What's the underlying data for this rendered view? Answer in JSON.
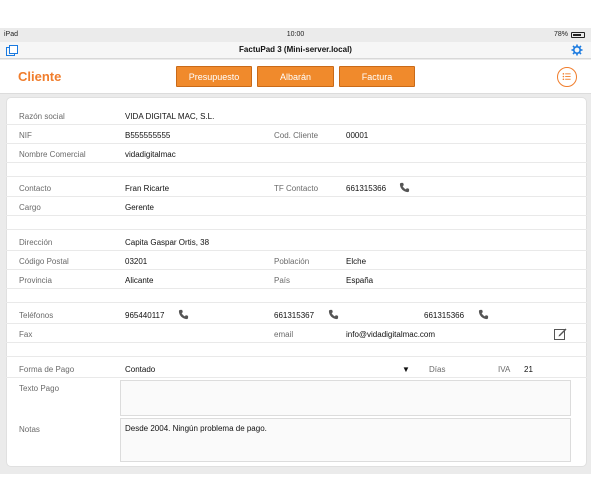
{
  "status_bar": {
    "left": "iPad",
    "time": "10:00",
    "battery": "78%"
  },
  "nav": {
    "title": "FactuPad 3 (Mini-server.local)"
  },
  "toolbar": {
    "screen_title": "Cliente",
    "buttons": [
      "Presupuesto",
      "Albarán",
      "Factura"
    ]
  },
  "form": {
    "razon_social": {
      "label": "Razón social",
      "value": "VIDA DIGITAL MAC, S.L."
    },
    "nif": {
      "label": "NIF",
      "value": "B555555555"
    },
    "cod_cliente": {
      "label": "Cod. Cliente",
      "value": "00001"
    },
    "nombre_comercial": {
      "label": "Nombre Comercial",
      "value": "vidadigitalmac"
    },
    "contacto": {
      "label": "Contacto",
      "value": "Fran Ricarte"
    },
    "tf_contacto": {
      "label": "TF Contacto",
      "value": "661315366"
    },
    "cargo": {
      "label": "Cargo",
      "value": "Gerente"
    },
    "direccion": {
      "label": "Dirección",
      "value": "Capita Gaspar Ortis, 38"
    },
    "codigo_postal": {
      "label": "Código Postal",
      "value": "03201"
    },
    "poblacion": {
      "label": "Población",
      "value": "Elche"
    },
    "provincia": {
      "label": "Provincia",
      "value": "Alicante"
    },
    "pais": {
      "label": "País",
      "value": "España"
    },
    "telefonos": {
      "label": "Teléfonos",
      "values": [
        "965440117",
        "661315367",
        "661315366"
      ]
    },
    "fax": {
      "label": "Fax",
      "value": ""
    },
    "email": {
      "label": "email",
      "value": "info@vidadigitalmac.com"
    },
    "forma_pago": {
      "label": "Forma de Pago",
      "value": "Contado"
    },
    "dias": {
      "label": "Días",
      "value": ""
    },
    "iva": {
      "label": "IVA",
      "value": "21"
    },
    "texto_pago": {
      "label": "Texto Pago",
      "value": ""
    },
    "notas": {
      "label": "Notas",
      "value": "Desde 2004. Ningún problema de pago."
    }
  },
  "colors": {
    "accent": "#f07d2c",
    "ios_blue": "#1a7ae0"
  },
  "icons": [
    "sidebar-toggle-icon",
    "gear-icon",
    "menu-list-icon",
    "phone-icon",
    "edit-icon",
    "dropdown-arrow-icon"
  ]
}
